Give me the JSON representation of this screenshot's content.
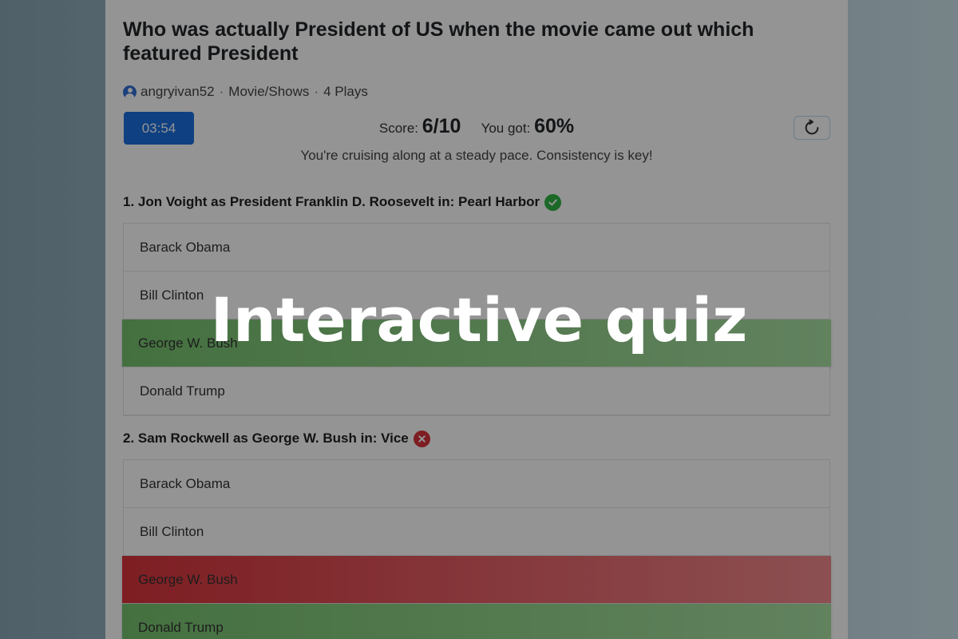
{
  "quiz": {
    "title": "Who was actually President of US when the movie came out which featured President",
    "author": "angryivan52",
    "category": "Movie/Shows",
    "plays": "4 Plays",
    "timer": "03:54",
    "score_label": "Score:",
    "score_value": "6/10",
    "got_label": "You got:",
    "got_value": "60%",
    "feedback": "You're cruising along at a steady pace. Consistency is key!"
  },
  "questions": [
    {
      "text": "1. Jon Voight as President Franklin D. Roosevelt in: Pearl Harbor",
      "status": "correct",
      "answers": [
        "Barack Obama",
        "Bill Clinton",
        "George W. Bush",
        "Donald Trump"
      ]
    },
    {
      "text": "2. Sam Rockwell as George W. Bush in: Vice",
      "status": "incorrect",
      "answers": [
        "Barack Obama",
        "Bill Clinton",
        "George W. Bush",
        "Donald Trump"
      ]
    }
  ],
  "overlay_label": "Interactive quiz",
  "colors": {
    "timer_bg": "#1b6fe0",
    "correct": "#76c26e",
    "wrong": "#d9343c",
    "correct_badge": "#2fb344",
    "wrong_badge": "#d9343c"
  },
  "icons": {
    "user": "user-circle-icon",
    "replay": "replay-icon",
    "correct": "check-circle-icon",
    "incorrect": "x-circle-icon"
  }
}
